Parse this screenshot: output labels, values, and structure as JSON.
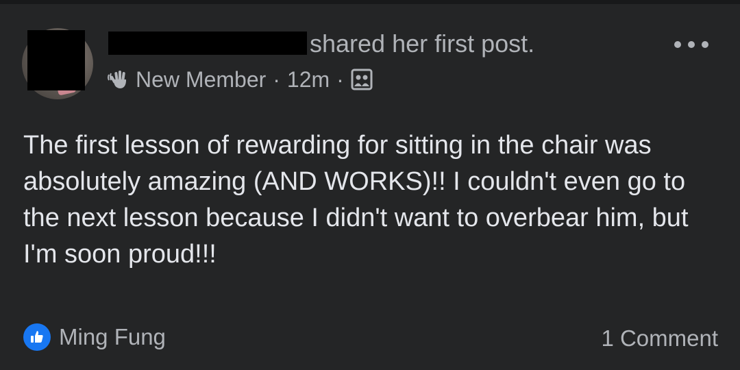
{
  "post": {
    "action_text": "shared her first post.",
    "meta": {
      "badge": "New Member",
      "separator": "·",
      "time": "12m",
      "audience_icon": "group-icon"
    },
    "more_icon": "more-options-icon",
    "body": "The first lesson of rewarding for sitting in the chair was absolutely amazing (AND WORKS)!! I couldn't even go to the next lesson because I didn't want to overbear him, but I'm soon proud!!!",
    "reactions": {
      "icon": "like-icon",
      "name": "Ming Fung"
    },
    "comments_label": "1 Comment"
  },
  "colors": {
    "background": "#242526",
    "primary_text": "#e4e6eb",
    "secondary_text": "#b0b3b8",
    "like_blue": "#1877f2"
  }
}
